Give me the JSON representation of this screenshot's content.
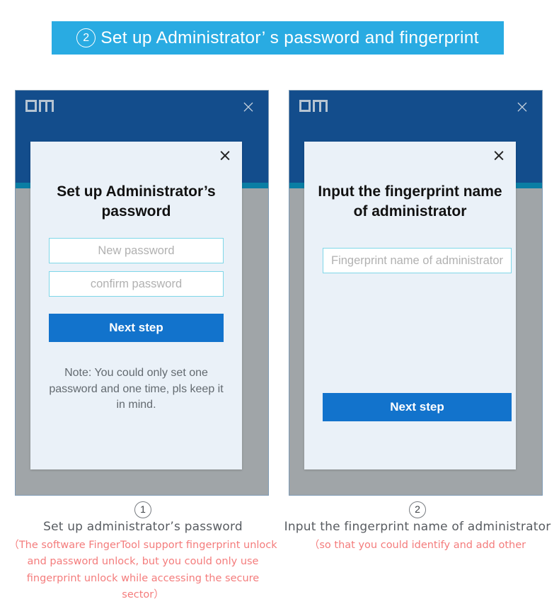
{
  "banner": {
    "number": "②",
    "number_plain": "2",
    "text": "Set up  Administrator’  s  password and fingerprint",
    "bg_color": "#29abe2",
    "text_color": "#ffffff"
  },
  "colors": {
    "window_header": "#134d8c",
    "window_accent": "#0a7ea4",
    "window_body": "#a0a5a8",
    "dialog_bg": "#eaf1f8",
    "input_border": "#7fd7e8",
    "primary_button": "#1273cc",
    "note_text": "#636a70",
    "caption_note": "#f47c7c"
  },
  "windows": [
    {
      "id": "left",
      "logo": "DM",
      "close_icon": "×",
      "dialog": {
        "close_icon": "×",
        "title": "Set up  Administrator’s password",
        "fields": [
          {
            "name": "new-password",
            "placeholder": "New password",
            "value": "",
            "align": "center"
          },
          {
            "name": "confirm-password",
            "placeholder": "confirm password",
            "value": "",
            "align": "center"
          }
        ],
        "button_label": "Next step",
        "note": "Note: You could only set one password and one time, pls keep it in mind."
      },
      "caption": {
        "number": "①",
        "number_plain": "1",
        "main": "Set up  administrator’s  password",
        "sub": "（The software FingerTool support fingerprint unlock and password unlock, but you could only use fingerprint unlock while accessing the secure sector）"
      }
    },
    {
      "id": "right",
      "logo": "DM",
      "close_icon": "×",
      "dialog": {
        "close_icon": "×",
        "title": "Input the fingerprint name of administrator",
        "fields": [
          {
            "name": "fingerprint-name",
            "placeholder": "Fingerprint name of administrator",
            "value": "",
            "align": "left"
          }
        ],
        "button_label": "Next step",
        "note": ""
      },
      "caption": {
        "number": "②",
        "number_plain": "2",
        "main": "Input the  fingerprint name of administrator",
        "sub": "（so that you could identify and add other"
      }
    }
  ]
}
